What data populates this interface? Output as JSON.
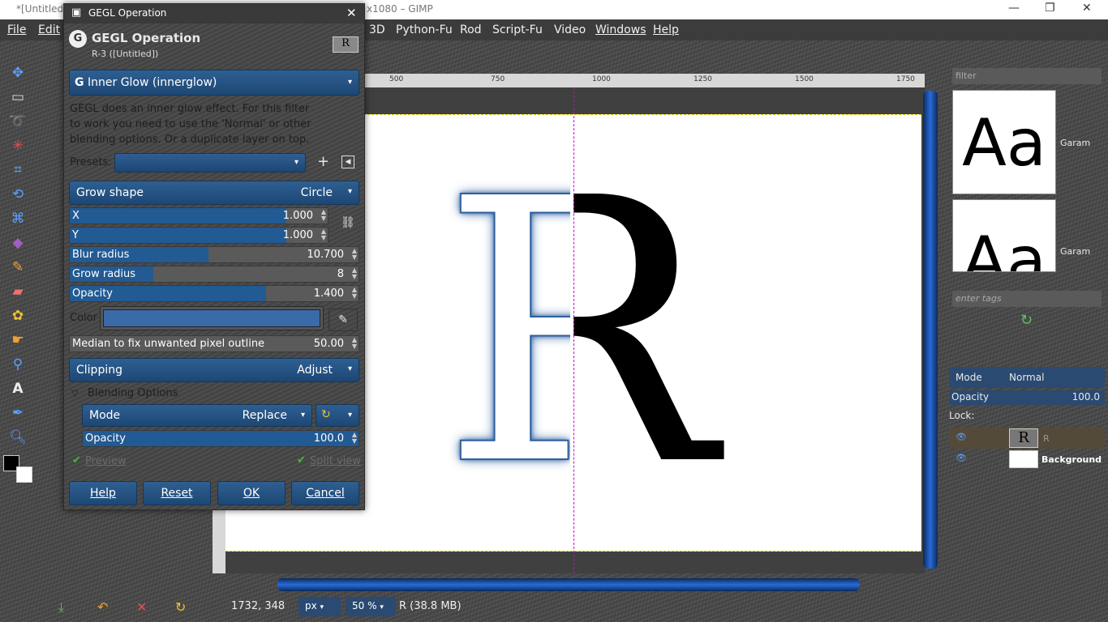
{
  "window": {
    "title_left": "*[Untitled]",
    "title_right": "x1080 – GIMP",
    "minimize": "—",
    "maximize": "❐",
    "close": "✕"
  },
  "menubar": {
    "items": [
      "File",
      "Edit",
      "3D",
      "Python-Fu",
      "Rod",
      "Script-Fu",
      "Video",
      "Windows",
      "Help"
    ]
  },
  "ruler": {
    "ticks": [
      "500",
      "750",
      "1000",
      "1250",
      "1500",
      "1750"
    ]
  },
  "canvas": {
    "letter": "R",
    "accent_color": "#2a5a98"
  },
  "status": {
    "coords": "1732, 348",
    "unit": "px",
    "zoom": "50 %",
    "info": "R (38.8 MB)"
  },
  "dock": {
    "filter_placeholder": "filter",
    "font_sample": "Aa",
    "font_name_1": "Garam",
    "font_name_2": "Garam",
    "tags_placeholder": "enter tags",
    "mode_label": "Mode",
    "mode_value": "Normal",
    "opacity_label": "Opacity",
    "opacity_value": "100.0",
    "lock_label": "Lock:",
    "layers": [
      {
        "name": "R"
      },
      {
        "name": "Background"
      }
    ]
  },
  "dialog": {
    "window_title": "GEGL Operation",
    "header_title": "GEGL Operation",
    "header_subtitle": "R-3 ([Untitled])",
    "thumb_letter": "R",
    "operation": "Inner Glow (innerglow)",
    "description": "GEGL does an inner glow effect. For this filter to work you need to use the 'Normal' or other blending options. Or a duplicate layer on top.",
    "presets_label": "Presets:",
    "grow_shape_label": "Grow shape",
    "grow_shape_value": "Circle",
    "fields": {
      "x": {
        "label": "X",
        "value": "1.000",
        "fill": 0.84
      },
      "y": {
        "label": "Y",
        "value": "1.000",
        "fill": 0.84
      },
      "blur": {
        "label": "Blur radius",
        "value": "10.700",
        "fill": 0.48
      },
      "grow": {
        "label": "Grow radius",
        "value": "8",
        "fill": 0.29
      },
      "opacity": {
        "label": "Opacity",
        "value": "1.400",
        "fill": 0.68
      },
      "median": {
        "label": "Median to fix unwanted pixel outline",
        "value": "50.00"
      }
    },
    "color_label": "Color",
    "color_value": "#3a6aa8",
    "clipping_label": "Clipping",
    "clipping_value": "Adjust",
    "blending_label": "Blending Options",
    "mode_label": "Mode",
    "mode_value": "Replace",
    "blend_opacity_label": "Opacity",
    "blend_opacity_value": "100.0",
    "preview_label": "Preview",
    "split_label": "Split view",
    "buttons": {
      "help": "Help",
      "reset": "Reset",
      "ok": "OK",
      "cancel": "Cancel"
    }
  }
}
